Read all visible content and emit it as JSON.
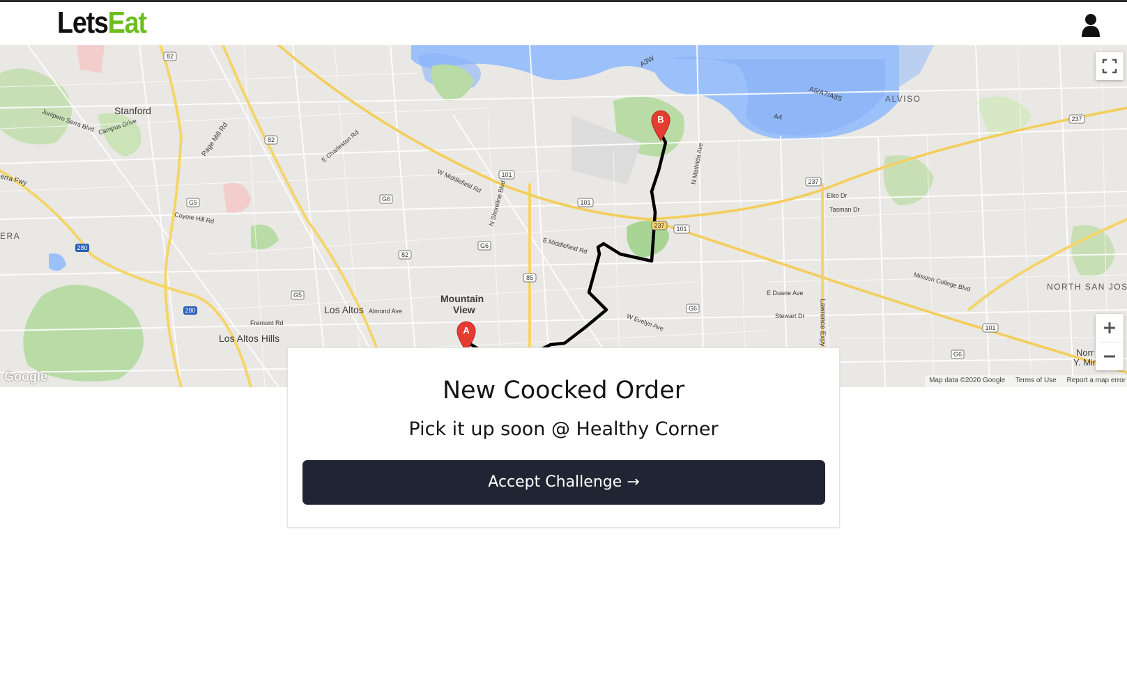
{
  "header": {
    "logo_part1": "Lets",
    "logo_part2": "Eat",
    "logo_colors": {
      "part1": "#111111",
      "part2": "#6cbd1e"
    },
    "user_icon": "user-icon"
  },
  "map": {
    "places": {
      "stanford": "Stanford",
      "los_altos": "Los Altos",
      "los_altos_hills": "Los Altos Hills",
      "mountain_view_1": "Mountain",
      "mountain_view_2": "View",
      "alviso": "ALVISO",
      "north_san_jose": "NORTH SAN JOS",
      "era": "ERA",
      "y_mineta": "Y. Mineta",
      "norm": "Norr"
    },
    "roads": {
      "junipero": "Junipero Serra Blvd",
      "campus": "Campus Drive",
      "page_mill": "Page Mill Rd",
      "el_camino": "E Charleston Rd",
      "middlefield": "W Middlefield Rd",
      "shoreline": "N Shoreline Blvd",
      "central": "E Middlefield Rd",
      "mathilda": "N Mathilda Ave",
      "tasman": "Tasman Dr",
      "lawrence": "Lawrence Expy",
      "e_duane": "E Duane Ave",
      "w_evelyn": "W Evelyn Ave",
      "a3w": "A3W",
      "a4": "A4",
      "a5": "A5/A7/A8S",
      "almond": "Almond Ave",
      "fremont": "Fremont Rd",
      "stewart": "Stewart Dr",
      "coyote": "Coyote Hill Rd",
      "sierra": "erra Fwy",
      "mission": "Mission College Blvd",
      "elko": "Elko Dr"
    },
    "highways": [
      "82",
      "280",
      "G5",
      "G6",
      "101",
      "237",
      "85",
      "101",
      "237",
      "G6"
    ],
    "markers": {
      "start": "A",
      "end": "B"
    },
    "route_color": "#000000",
    "marker_color": "#e53b30",
    "google_logo": "Google",
    "footer": {
      "map_data": "Map data ©2020 Google",
      "terms": "Terms of Use",
      "report": "Report a map error"
    },
    "controls": {
      "fullscreen_icon": "fullscreen-icon",
      "zoom_in_icon": "plus-icon",
      "zoom_out_icon": "minus-icon"
    }
  },
  "order_card": {
    "title": "New Coocked Order",
    "subtitle": "Pick it up soon @ Healthy Corner",
    "button_label": "Accept Challenge →",
    "button_color": "#1f2533"
  }
}
